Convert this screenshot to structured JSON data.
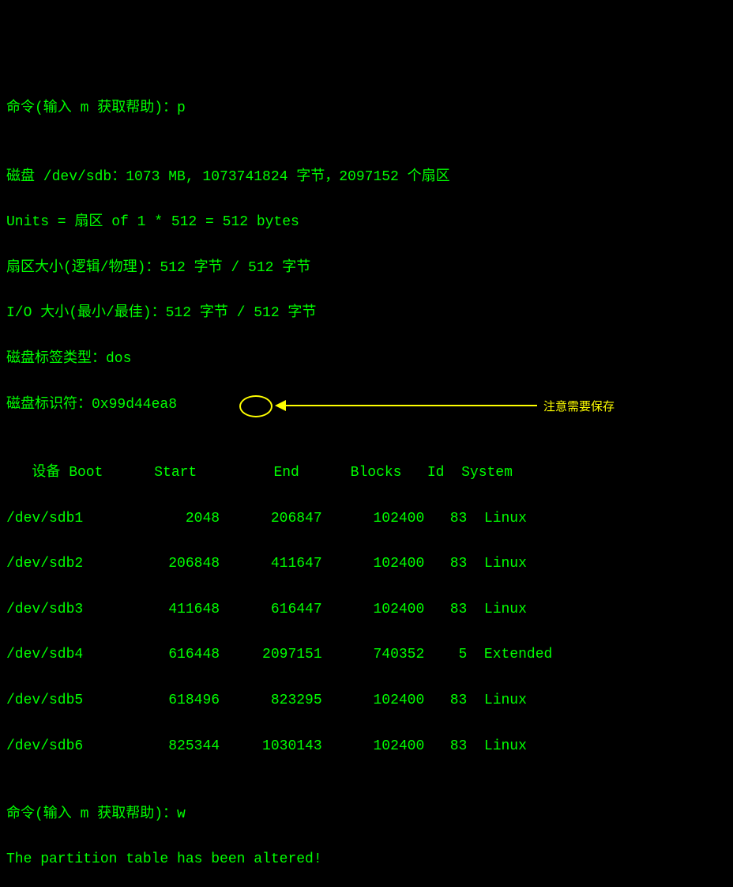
{
  "prompt1": "命令(输入 m 获取帮助)：p",
  "blank1": "",
  "disk_line1": "磁盘 /dev/sdb：1073 MB, 1073741824 字节，2097152 个扇区",
  "disk_line2": "Units = 扇区 of 1 * 512 = 512 bytes",
  "disk_line3": "扇区大小(逻辑/物理)：512 字节 / 512 字节",
  "disk_line4": "I/O 大小(最小/最佳)：512 字节 / 512 字节",
  "disk_line5": "磁盘标签类型：dos",
  "disk_line6": "磁盘标识符：0x99d44ea8",
  "blank2": "",
  "table_header": "   设备 Boot      Start         End      Blocks   Id  System",
  "rows": [
    "/dev/sdb1            2048      206847      102400   83  Linux",
    "/dev/sdb2          206848      411647      102400   83  Linux",
    "/dev/sdb3          411648      616447      102400   83  Linux",
    "/dev/sdb4          616448     2097151      740352    5  Extended",
    "/dev/sdb5          618496      823295      102400   83  Linux",
    "/dev/sdb6          825344     1030143      102400   83  Linux"
  ],
  "blank3": "",
  "prompt2": "命令(输入 m 获取帮助)：w",
  "result": "The partition table has been altered!",
  "annotation": "注意需要保存",
  "chart_data": {
    "type": "table",
    "title": "fdisk partition table for /dev/sdb",
    "columns": [
      "设备",
      "Boot",
      "Start",
      "End",
      "Blocks",
      "Id",
      "System"
    ],
    "rows": [
      {
        "device": "/dev/sdb1",
        "boot": "",
        "start": 2048,
        "end": 206847,
        "blocks": 102400,
        "id": "83",
        "system": "Linux"
      },
      {
        "device": "/dev/sdb2",
        "boot": "",
        "start": 206848,
        "end": 411647,
        "blocks": 102400,
        "id": "83",
        "system": "Linux"
      },
      {
        "device": "/dev/sdb3",
        "boot": "",
        "start": 411648,
        "end": 616447,
        "blocks": 102400,
        "id": "83",
        "system": "Linux"
      },
      {
        "device": "/dev/sdb4",
        "boot": "",
        "start": 616448,
        "end": 2097151,
        "blocks": 740352,
        "id": "5",
        "system": "Extended"
      },
      {
        "device": "/dev/sdb5",
        "boot": "",
        "start": 618496,
        "end": 823295,
        "blocks": 102400,
        "id": "83",
        "system": "Linux"
      },
      {
        "device": "/dev/sdb6",
        "boot": "",
        "start": 825344,
        "end": 1030143,
        "blocks": 102400,
        "id": "83",
        "system": "Linux"
      }
    ],
    "disk_info": {
      "device": "/dev/sdb",
      "size_mb": 1073,
      "size_bytes": 1073741824,
      "sectors": 2097152,
      "sector_unit": 512,
      "label_type": "dos",
      "identifier": "0x99d44ea8"
    }
  }
}
